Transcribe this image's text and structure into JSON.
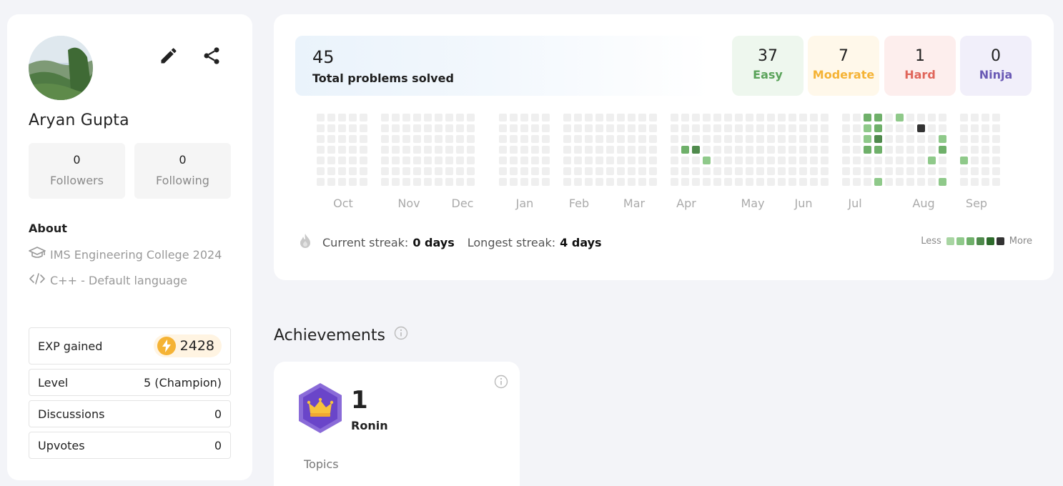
{
  "profile": {
    "name": "Aryan Gupta",
    "followers": {
      "count": "0",
      "label": "Followers"
    },
    "following": {
      "count": "0",
      "label": "Following"
    },
    "about_title": "About",
    "college": "IMS Engineering College 2024",
    "language": "C++ - Default language",
    "stats": {
      "exp_label": "EXP gained",
      "exp_value": "2428",
      "level_label": "Level",
      "level_value": "5 (Champion)",
      "discussions_label": "Discussions",
      "discussions_value": "0",
      "upvotes_label": "Upvotes",
      "upvotes_value": "0"
    }
  },
  "summary": {
    "total": "45",
    "total_label": "Total problems solved",
    "difficulties": [
      {
        "count": "37",
        "label": "Easy",
        "color": "#5aa35a",
        "bg": "#eef7ee"
      },
      {
        "count": "7",
        "label": "Moderate",
        "color": "#f5b335",
        "bg": "#fff8ea"
      },
      {
        "count": "1",
        "label": "Hard",
        "color": "#e0655a",
        "bg": "#fdeeed"
      },
      {
        "count": "0",
        "label": "Ninja",
        "color": "#6a5ab5",
        "bg": "#f1effa"
      }
    ]
  },
  "heatmap": {
    "months": [
      "Oct",
      "Nov",
      "Dec",
      "Jan",
      "Feb",
      "Mar",
      "Apr",
      "May",
      "Jun",
      "Jul",
      "Aug",
      "Sep"
    ],
    "empty_color": "#efefef",
    "level_colors": [
      "#a8d5a2",
      "#8fc98a",
      "#6fb06a",
      "#4f8a4c",
      "#2e6b2c",
      "#333333"
    ],
    "active": [
      {
        "month": "Apr",
        "week": 1,
        "day": 3,
        "level": 2
      },
      {
        "month": "Apr",
        "week": 2,
        "day": 3,
        "level": 3
      },
      {
        "month": "Apr",
        "week": 3,
        "day": 4,
        "level": 1
      },
      {
        "month": "Jul",
        "week": 2,
        "day": 0,
        "level": 2
      },
      {
        "month": "Jul",
        "week": 3,
        "day": 0,
        "level": 2
      },
      {
        "month": "Jul",
        "week": 2,
        "day": 1,
        "level": 1
      },
      {
        "month": "Jul",
        "week": 3,
        "day": 1,
        "level": 2
      },
      {
        "month": "Jul",
        "week": 2,
        "day": 2,
        "level": 1
      },
      {
        "month": "Jul",
        "week": 3,
        "day": 2,
        "level": 3
      },
      {
        "month": "Jul",
        "week": 2,
        "day": 3,
        "level": 2
      },
      {
        "month": "Jul",
        "week": 3,
        "day": 3,
        "level": 2
      },
      {
        "month": "Jul",
        "week": 3,
        "day": 6,
        "level": 1
      },
      {
        "month": "Aug",
        "week": 0,
        "day": 0,
        "level": 1
      },
      {
        "month": "Aug",
        "week": 2,
        "day": 1,
        "level": 5
      },
      {
        "month": "Aug",
        "week": -1,
        "day": 2,
        "level": 1
      },
      {
        "month": "Aug",
        "week": -1,
        "day": 3,
        "level": 2
      },
      {
        "month": "Aug",
        "week": -1,
        "day": 6,
        "level": 1
      },
      {
        "month": "Aug",
        "week": 3,
        "day": 4,
        "level": 1
      },
      {
        "month": "Sep",
        "week": 0,
        "day": 4,
        "level": 1
      }
    ]
  },
  "streak": {
    "current_label": "Current streak:",
    "current_value": "0 days",
    "longest_label": "Longest streak:",
    "longest_value": "4 days"
  },
  "legend": {
    "less": "Less",
    "more": "More"
  },
  "achievements": {
    "title": "Achievements",
    "count": "1",
    "rank": "Ronin",
    "topics_label": "Topics"
  }
}
